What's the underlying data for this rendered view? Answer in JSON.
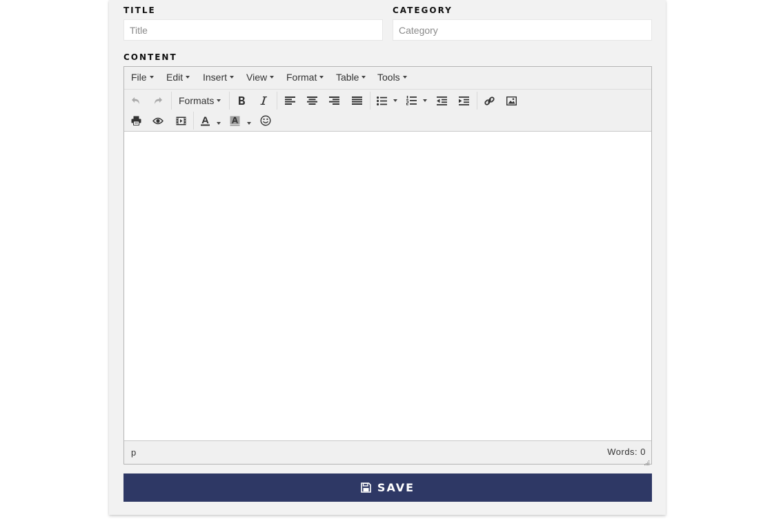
{
  "form": {
    "title_label": "TITLE",
    "title_placeholder": "Title",
    "title_value": "",
    "category_label": "CATEGORY",
    "category_placeholder": "Category",
    "category_value": "",
    "content_label": "CONTENT"
  },
  "editor": {
    "menus": [
      "File",
      "Edit",
      "Insert",
      "View",
      "Format",
      "Table",
      "Tools"
    ],
    "formats_label": "Formats",
    "status_path": "p",
    "word_count": "Words: 0",
    "content": ""
  },
  "save_button": {
    "label": "SAVE",
    "color": "#2e3865"
  }
}
